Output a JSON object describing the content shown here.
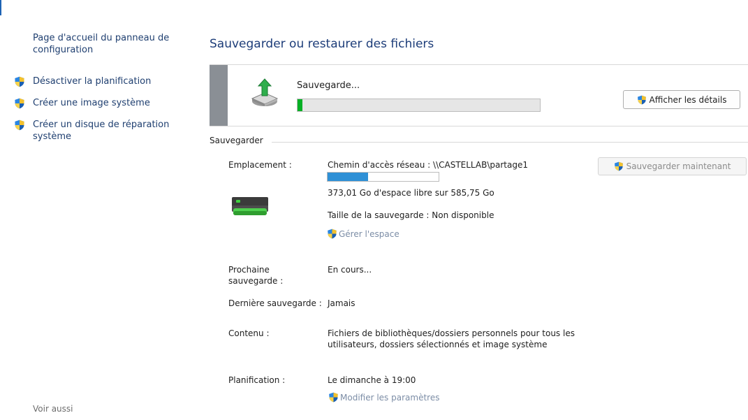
{
  "sidebar": {
    "home_link": "Page d'accueil du panneau de configuration",
    "tasks": [
      {
        "label": "Désactiver la planification",
        "icon": "uac-shield-icon"
      },
      {
        "label": "Créer une image système",
        "icon": "uac-shield-icon"
      },
      {
        "label": "Créer un disque de réparation système",
        "icon": "uac-shield-icon"
      }
    ],
    "see_also": "Voir aussi"
  },
  "main": {
    "title": "Sauvegarder ou restaurer des fichiers",
    "progress_panel": {
      "icon": "backup-in-progress-icon",
      "status": "Sauvegarde...",
      "progress": 0.02,
      "details_button": "Afficher les détails"
    },
    "section": {
      "label": "Sauvegarder",
      "location_label": "Emplacement :",
      "location_value": "Chemin d'accès réseau : \\\\CASTELLAB\\partage1",
      "space_used_fraction": 0.363,
      "free_space": "373,01 Go d'espace libre sur 585,75 Go",
      "backup_size": "Taille de la sauvegarde : Non disponible",
      "manage_space_link": "Gérer l'espace",
      "backup_now_button": "Sauvegarder maintenant",
      "next_backup_label": "Prochaine sauvegarde :",
      "next_backup_value": "En cours...",
      "last_backup_label": "Dernière sauvegarde :",
      "last_backup_value": "Jamais",
      "content_label": "Contenu :",
      "content_value": "Fichiers de bibliothèques/dossiers personnels pour tous les utilisateurs, dossiers sélectionnés et image système",
      "schedule_label": "Planification :",
      "schedule_value": "Le dimanche à 19:00",
      "change_settings_link": "Modifier les paramètres"
    }
  },
  "colors": {
    "link": "#1f3f70",
    "title": "#1d3d79",
    "progress_green": "#06b025",
    "disk_bar_blue": "#2f90d6",
    "panel_stripe": "#8a8f95"
  }
}
